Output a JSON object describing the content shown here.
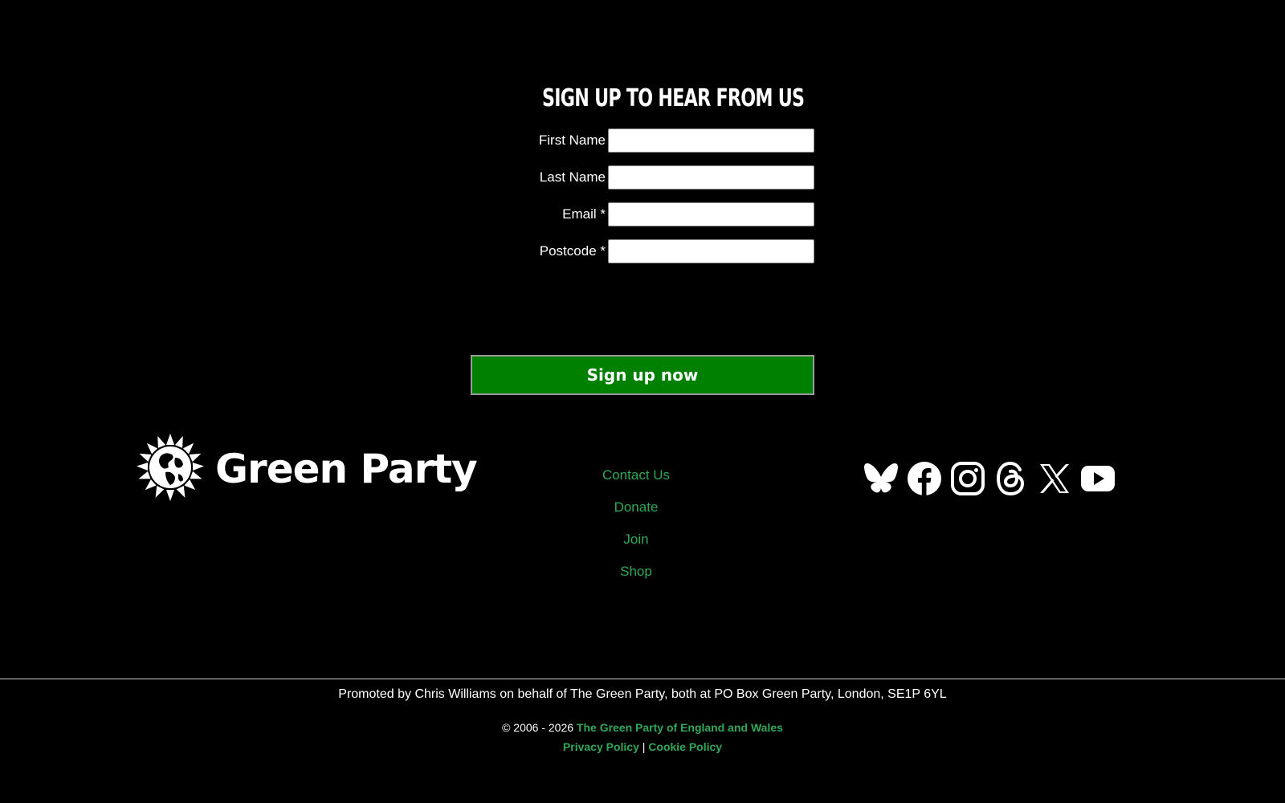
{
  "signup": {
    "heading": "SIGN UP TO HEAR FROM US",
    "fields": [
      {
        "label": "First Name",
        "value": ""
      },
      {
        "label": "Last Name",
        "value": ""
      },
      {
        "label": "Email *",
        "value": ""
      },
      {
        "label": "Postcode *",
        "value": ""
      }
    ],
    "button_label": "Sign up now"
  },
  "logo": {
    "text": "Green Party",
    "icon": "sunflower-globe-icon"
  },
  "footer_nav": {
    "items": [
      "Contact Us",
      "Donate",
      "Join",
      "Shop"
    ]
  },
  "social": {
    "icons": [
      "bluesky-icon",
      "facebook-icon",
      "instagram-icon",
      "threads-icon",
      "x-icon",
      "youtube-icon"
    ]
  },
  "legal": {
    "promoted": "Promoted by Chris Williams on behalf of The Green Party, both at PO Box Green Party, London, SE1P 6YL",
    "copyright_prefix": "© 2006 - 2026",
    "copyright_link": "The Green Party of England and Wales",
    "privacy_label": "Privacy Policy",
    "separator": "|",
    "cookie_label": "Cookie Policy"
  },
  "colors": {
    "background": "#000000",
    "button_green": "#008000",
    "link_green": "#2fa85a",
    "text": "#ffffff"
  }
}
